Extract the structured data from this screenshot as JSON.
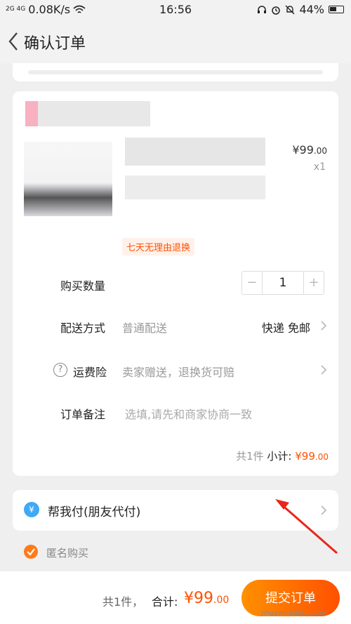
{
  "status": {
    "signal": "2G 4G",
    "speed": "0.08K/s",
    "time": "16:56",
    "battery": "44%"
  },
  "header": {
    "title": "确认订单"
  },
  "item": {
    "price_main": "¥99",
    "price_dec": ".00",
    "qty": "x1",
    "tag": "七天无理由退换"
  },
  "rows": {
    "quantity_label": "购买数量",
    "quantity_value": "1",
    "minus": "−",
    "plus": "+",
    "delivery_label": "配送方式",
    "delivery_value": "普通配送",
    "delivery_right": "快递 免邮",
    "insurance_icon": "?",
    "insurance_label": "运费险",
    "insurance_value": "卖家赠送，退换货可赔",
    "note_label": "订单备注",
    "note_placeholder": "选填,请先和商家协商一致"
  },
  "subtotal": {
    "count": "共1件",
    "label": "小计:",
    "amount": "¥99",
    "amount_dec": ".00"
  },
  "pay": {
    "icon": "¥",
    "label": "帮我付(朋友代付)"
  },
  "anon": {
    "label": "匿名购买"
  },
  "footer": {
    "count": "共1件，",
    "total_label": "合计:",
    "total": "¥99",
    "total_dec": ".00",
    "submit": "提交订单"
  },
  "watermark": "jingyan.baidu.com",
  "colors": {
    "accent": "#ff5000",
    "pay_icon": "#3fa9f5"
  }
}
